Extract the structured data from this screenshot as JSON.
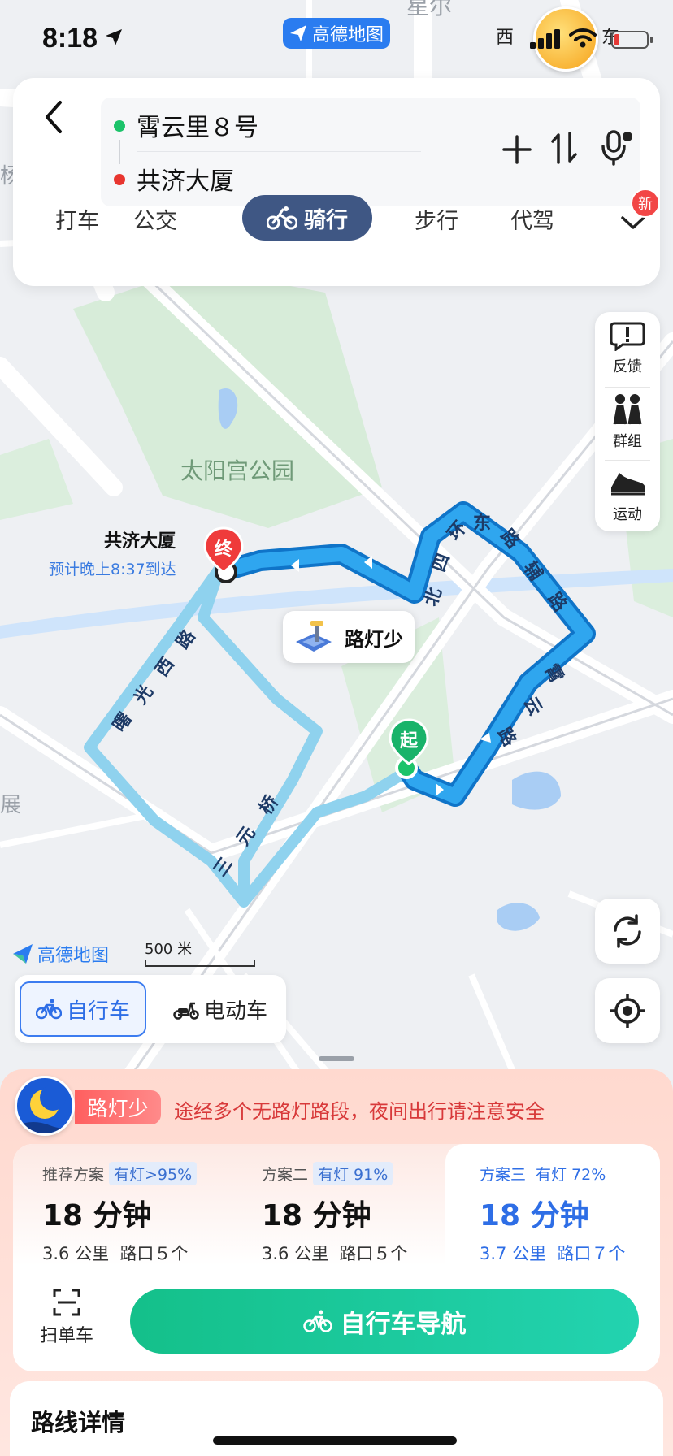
{
  "status": {
    "time": "8:18"
  },
  "app_pill": "高德地图",
  "compass": {
    "west": "西",
    "east": "东"
  },
  "route": {
    "start": "霄云里８号",
    "end": "共济大厦"
  },
  "modes": [
    "打车",
    "公交",
    "骑行",
    "步行",
    "代驾"
  ],
  "active_mode": "骑行",
  "new_badge": "新",
  "tools": {
    "feedback": "反馈",
    "group": "群组",
    "sport": "运动"
  },
  "map": {
    "park": "太阳宫公园",
    "top_label": "星尔",
    "left_top": "杨",
    "left_mid": "展",
    "roads": {
      "r1": [
        "北",
        "四",
        "环",
        "东",
        "路",
        "辅",
        "路"
      ],
      "r2": [
        "霄",
        "云",
        "路"
      ],
      "r3": [
        "曙",
        "光",
        "西",
        "路"
      ],
      "r4": [
        "三",
        "元",
        "桥"
      ]
    },
    "dest_name": "共济大厦",
    "dest_eta": "预计晚上8:37到达",
    "end_marker": "终",
    "start_marker": "起",
    "light_tip": "路灯少",
    "logo": "高德地图",
    "scale": "500 米"
  },
  "vehicle": {
    "bike": "自行车",
    "ebike": "电动车"
  },
  "warning": {
    "tag": "路灯少",
    "text": "途经多个无路灯路段，夜间出行请注意安全"
  },
  "plans": [
    {
      "name": "推荐方案",
      "light": "有灯>95%",
      "time": "18 分钟",
      "distance": "3.6 公里",
      "junctions": "路口５个"
    },
    {
      "name": "方案二",
      "light": "有灯 91%",
      "time": "18 分钟",
      "distance": "3.6 公里",
      "junctions": "路口５个"
    },
    {
      "name": "方案三",
      "light": "有灯 72%",
      "time": "18 分钟",
      "distance": "3.7 公里",
      "junctions": "路口７个"
    }
  ],
  "scan_label": "扫单车",
  "nav_label": "自行车导航",
  "detail_title": "路线详情",
  "colors": {
    "route_selected": "#1a9ae8",
    "route_alt": "#9ed6f0",
    "nav_button": "#14c08a",
    "accent": "#2e6ee6"
  }
}
